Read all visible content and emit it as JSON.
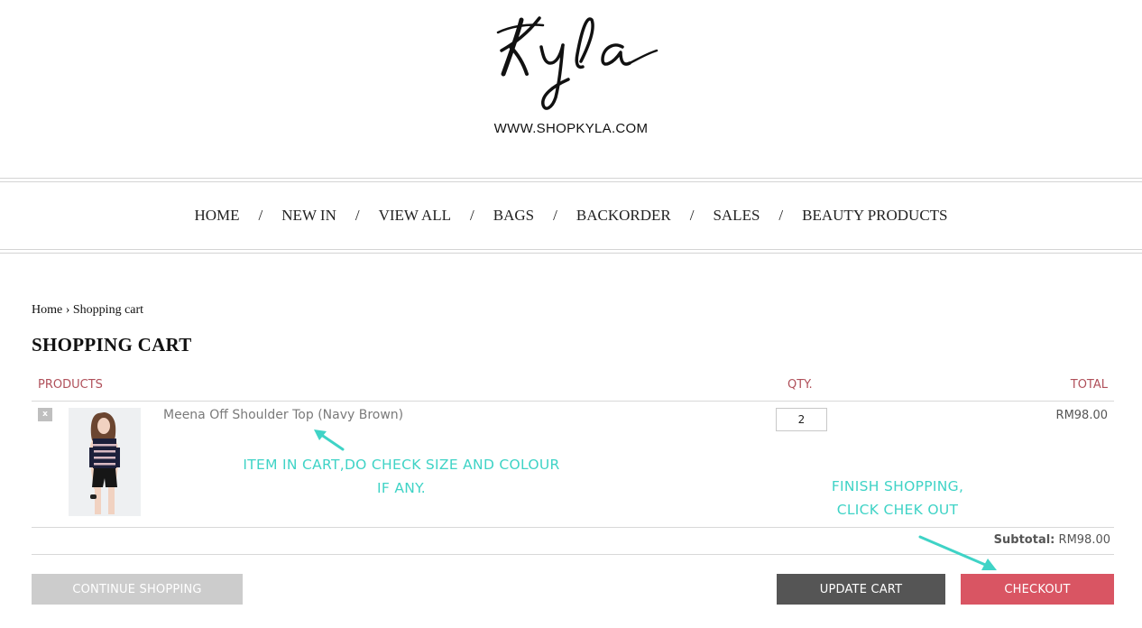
{
  "header": {
    "logo_text": "Kyla",
    "site_url": "WWW.SHOPKYLA.COM"
  },
  "nav": {
    "items": [
      "HOME",
      "NEW IN",
      "VIEW ALL",
      "BAGS",
      "BACKORDER",
      "SALES",
      "BEAUTY PRODUCTS"
    ],
    "separator": "/"
  },
  "breadcrumb": {
    "home": "Home",
    "separator": "›",
    "current": "Shopping cart"
  },
  "page_title": "SHOPPING CART",
  "cart": {
    "headers": {
      "products": "PRODUCTS",
      "qty": "QTY.",
      "total": "TOTAL"
    },
    "items": [
      {
        "remove_label": "x",
        "name": "Meena Off Shoulder Top (Navy Brown)",
        "qty": "2",
        "total": "RM98.00"
      }
    ],
    "subtotal_label": "Subtotal:",
    "subtotal_value": "RM98.00"
  },
  "buttons": {
    "continue": "CONTINUE SHOPPING",
    "update": "UPDATE CART",
    "checkout": "CHECKOUT"
  },
  "annotations": {
    "cart_note_line1": "ITEM IN CART,DO CHECK SIZE AND COLOUR",
    "cart_note_line2": "IF ANY.",
    "checkout_note_line1": "FINISH SHOPPING,",
    "checkout_note_line2": "CLICK CHEK OUT"
  },
  "colors": {
    "header_accent": "#b0505a",
    "checkout": "#d95563",
    "update": "#555555",
    "continue": "#cccccc",
    "annotation": "#3fd3c6"
  }
}
